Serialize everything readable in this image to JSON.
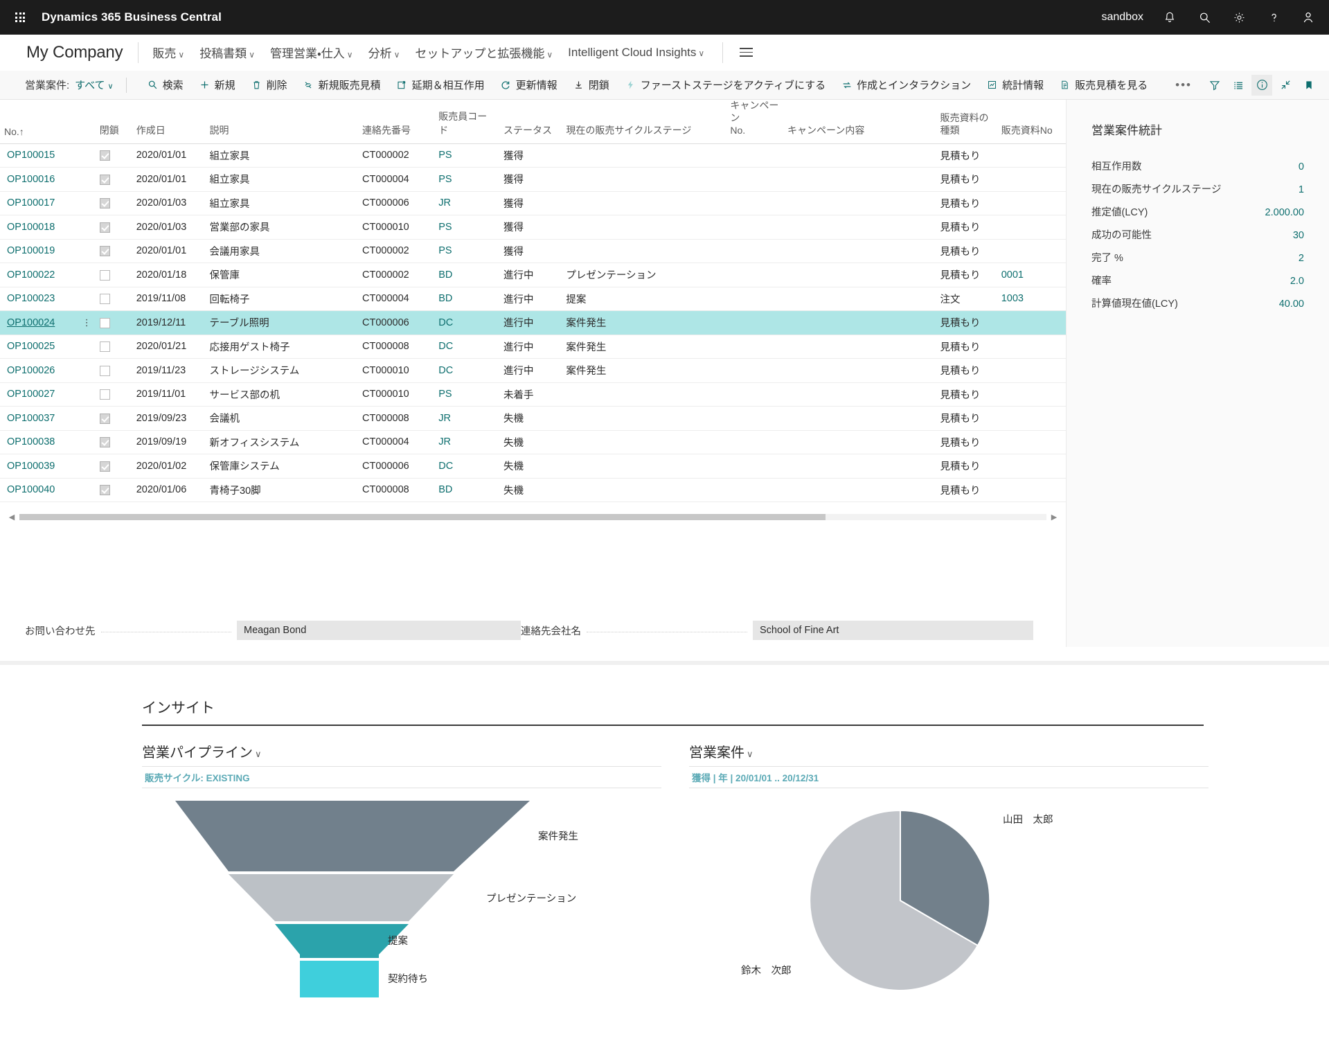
{
  "topbar": {
    "app_title": "Dynamics 365 Business Central",
    "environment": "sandbox",
    "waffle_icon": "app-launcher-icon",
    "icons": [
      "bell-icon",
      "search-icon",
      "gear-icon",
      "help-icon",
      "account-icon"
    ]
  },
  "navbar": {
    "company": "My Company",
    "items": [
      {
        "label": "販売",
        "caret": "∨"
      },
      {
        "label": "投稿書類",
        "caret": "∨"
      },
      {
        "label": "管理営業・仕入",
        "caret": "∨"
      },
      {
        "label": "分析",
        "caret": "∨"
      },
      {
        "label": "セットアップと拡張機能",
        "caret": "∨"
      },
      {
        "label": "Intelligent Cloud Insights",
        "caret": "∨"
      }
    ],
    "menu_icon": "hamburger-menu-icon"
  },
  "toolbar": {
    "filter_label": "営業案件:",
    "filter_value": "すべて",
    "filter_caret": "∨",
    "actions": [
      {
        "label": "検索",
        "icon": "search-icon"
      },
      {
        "label": "新規",
        "icon": "plus-icon"
      },
      {
        "label": "削除",
        "icon": "trash-icon"
      },
      {
        "label": "新規販売見積",
        "icon": "new-quote-icon"
      },
      {
        "label": "延期＆相互作用",
        "icon": "postpone-interaction-icon"
      },
      {
        "label": "更新情報",
        "icon": "refresh-icon"
      },
      {
        "label": "閉鎖",
        "icon": "close-down-icon"
      },
      {
        "label": "ファーストステージをアクティブにする",
        "icon": "lightning-icon"
      },
      {
        "label": "作成とインタラクション",
        "icon": "create-interaction-icon"
      },
      {
        "label": "統計情報",
        "icon": "statistics-icon"
      },
      {
        "label": "販売見積を見る",
        "icon": "view-quote-icon"
      }
    ],
    "overflow": "•••",
    "right_icons": [
      {
        "name": "filter-icon",
        "active": false
      },
      {
        "name": "list-view-icon",
        "active": false
      },
      {
        "name": "info-icon",
        "active": true
      },
      {
        "name": "collapse-icon",
        "active": false
      },
      {
        "name": "bookmark-icon",
        "active": false
      }
    ]
  },
  "grid": {
    "columns": [
      {
        "key": "no",
        "label": "No.",
        "sort": "↑"
      },
      {
        "key": "closed",
        "label": "閉鎖"
      },
      {
        "key": "created",
        "label": "作成日"
      },
      {
        "key": "description",
        "label": "説明"
      },
      {
        "key": "contact_no",
        "label": "連絡先番号"
      },
      {
        "key": "salesperson",
        "label": "販売員コード"
      },
      {
        "key": "status",
        "label": "ステータス"
      },
      {
        "key": "stage",
        "label": "現在の販売サイクルステージ"
      },
      {
        "key": "campaign_no",
        "label": "キャンペーン\nNo."
      },
      {
        "key": "campaign_desc",
        "label": "キャンペーン内容"
      },
      {
        "key": "doc_type",
        "label": "販売資料の\n種類"
      },
      {
        "key": "doc_no",
        "label": "販売資料No"
      }
    ],
    "rows": [
      {
        "no": "OP100015",
        "closed": true,
        "created": "2020/01/01",
        "description": "組立家具",
        "contact_no": "CT000002",
        "salesperson": "PS",
        "status": "獲得",
        "stage": "",
        "campaign_no": "",
        "campaign_desc": "",
        "doc_type": "見積もり",
        "doc_no": "",
        "selected": false
      },
      {
        "no": "OP100016",
        "closed": true,
        "created": "2020/01/01",
        "description": "組立家具",
        "contact_no": "CT000004",
        "salesperson": "PS",
        "status": "獲得",
        "stage": "",
        "campaign_no": "",
        "campaign_desc": "",
        "doc_type": "見積もり",
        "doc_no": "",
        "selected": false
      },
      {
        "no": "OP100017",
        "closed": true,
        "created": "2020/01/03",
        "description": "組立家具",
        "contact_no": "CT000006",
        "salesperson": "JR",
        "status": "獲得",
        "stage": "",
        "campaign_no": "",
        "campaign_desc": "",
        "doc_type": "見積もり",
        "doc_no": "",
        "selected": false
      },
      {
        "no": "OP100018",
        "closed": true,
        "created": "2020/01/03",
        "description": "営業部の家具",
        "contact_no": "CT000010",
        "salesperson": "PS",
        "status": "獲得",
        "stage": "",
        "campaign_no": "",
        "campaign_desc": "",
        "doc_type": "見積もり",
        "doc_no": "",
        "selected": false
      },
      {
        "no": "OP100019",
        "closed": true,
        "created": "2020/01/01",
        "description": "会議用家具",
        "contact_no": "CT000002",
        "salesperson": "PS",
        "status": "獲得",
        "stage": "",
        "campaign_no": "",
        "campaign_desc": "",
        "doc_type": "見積もり",
        "doc_no": "",
        "selected": false
      },
      {
        "no": "OP100022",
        "closed": false,
        "created": "2020/01/18",
        "description": "保管庫",
        "contact_no": "CT000002",
        "salesperson": "BD",
        "status": "進行中",
        "stage": "プレゼンテーション",
        "campaign_no": "",
        "campaign_desc": "",
        "doc_type": "見積もり",
        "doc_no": "0001",
        "selected": false
      },
      {
        "no": "OP100023",
        "closed": false,
        "created": "2019/11/08",
        "description": "回転椅子",
        "contact_no": "CT000004",
        "salesperson": "BD",
        "status": "進行中",
        "stage": "提案",
        "campaign_no": "",
        "campaign_desc": "",
        "doc_type": "注文",
        "doc_no": "1003",
        "selected": false
      },
      {
        "no": "OP100024",
        "closed": false,
        "created": "2019/12/11",
        "description": "テーブル照明",
        "contact_no": "CT000006",
        "salesperson": "DC",
        "status": "進行中",
        "stage": "案件発生",
        "campaign_no": "",
        "campaign_desc": "",
        "doc_type": "見積もり",
        "doc_no": "",
        "selected": true
      },
      {
        "no": "OP100025",
        "closed": false,
        "created": "2020/01/21",
        "description": "応接用ゲスト椅子",
        "contact_no": "CT000008",
        "salesperson": "DC",
        "status": "進行中",
        "stage": "案件発生",
        "campaign_no": "",
        "campaign_desc": "",
        "doc_type": "見積もり",
        "doc_no": "",
        "selected": false
      },
      {
        "no": "OP100026",
        "closed": false,
        "created": "2019/11/23",
        "description": "ストレージシステム",
        "contact_no": "CT000010",
        "salesperson": "DC",
        "status": "進行中",
        "stage": "案件発生",
        "campaign_no": "",
        "campaign_desc": "",
        "doc_type": "見積もり",
        "doc_no": "",
        "selected": false
      },
      {
        "no": "OP100027",
        "closed": false,
        "created": "2019/11/01",
        "description": "サービス部の机",
        "contact_no": "CT000010",
        "salesperson": "PS",
        "status": "未着手",
        "stage": "",
        "campaign_no": "",
        "campaign_desc": "",
        "doc_type": "見積もり",
        "doc_no": "",
        "selected": false
      },
      {
        "no": "OP100037",
        "closed": true,
        "created": "2019/09/23",
        "description": "会議机",
        "contact_no": "CT000008",
        "salesperson": "JR",
        "status": "失機",
        "stage": "",
        "campaign_no": "",
        "campaign_desc": "",
        "doc_type": "見積もり",
        "doc_no": "",
        "selected": false
      },
      {
        "no": "OP100038",
        "closed": true,
        "created": "2019/09/19",
        "description": "新オフィスシステム",
        "contact_no": "CT000004",
        "salesperson": "JR",
        "status": "失機",
        "stage": "",
        "campaign_no": "",
        "campaign_desc": "",
        "doc_type": "見積もり",
        "doc_no": "",
        "selected": false
      },
      {
        "no": "OP100039",
        "closed": true,
        "created": "2020/01/02",
        "description": "保管庫システム",
        "contact_no": "CT000006",
        "salesperson": "DC",
        "status": "失機",
        "stage": "",
        "campaign_no": "",
        "campaign_desc": "",
        "doc_type": "見積もり",
        "doc_no": "",
        "selected": false
      },
      {
        "no": "OP100040",
        "closed": true,
        "created": "2020/01/06",
        "description": "青椅子30脚",
        "contact_no": "CT000008",
        "salesperson": "BD",
        "status": "失機",
        "stage": "",
        "campaign_no": "",
        "campaign_desc": "",
        "doc_type": "見積もり",
        "doc_no": "",
        "selected": false
      }
    ]
  },
  "form": {
    "fields": [
      {
        "label": "お問い合わせ先",
        "value": "Meagan Bond"
      },
      {
        "label": "連絡先会社名",
        "value": "School of Fine Art"
      }
    ]
  },
  "factbox": {
    "title": "営業案件統計",
    "rows": [
      {
        "key": "相互作用数",
        "value": "0"
      },
      {
        "key": "現在の販売サイクルステージ",
        "value": "1"
      },
      {
        "key": "推定値(LCY)",
        "value": "2.000.00"
      },
      {
        "key": "成功の可能性",
        "value": "30"
      },
      {
        "key": "完了 %",
        "value": "2"
      },
      {
        "key": "確率",
        "value": "2.0"
      },
      {
        "key": "計算値現在値(LCY)",
        "value": "40.00"
      }
    ]
  },
  "insights": {
    "title": "インサイト",
    "charts": [
      {
        "heading": "営業パイプライン",
        "caret": "∨",
        "subtitle": "販売サイクル: EXISTING"
      },
      {
        "heading": "営業案件",
        "caret": "∨",
        "subtitle": "獲得 | 年 | 20/01/01 .. 20/12/31"
      }
    ]
  },
  "chart_data": [
    {
      "type": "funnel",
      "title": "営業パイプライン",
      "subtitle": "販売サイクル: EXISTING",
      "categories": [
        "案件発生",
        "プレゼンテーション",
        "提案",
        "契約待ち"
      ],
      "values": [
        100,
        56,
        30,
        30
      ],
      "colors": [
        "#71808c",
        "#bcc1c6",
        "#2ba3ab",
        "#3fcfdc"
      ],
      "legend": "right-labels",
      "notes": "Inverted funnel; widths decrease top to bottom, last two segments equal width"
    },
    {
      "type": "pie",
      "title": "営業案件",
      "subtitle": "獲得 | 年 | 20/01/01 .. 20/12/31",
      "labels": [
        "山田　太郎",
        "鈴木　次郎"
      ],
      "values": [
        25,
        75
      ],
      "colors": [
        "#72808b",
        "#c2c5ca"
      ],
      "legend": "outer-labels"
    }
  ]
}
